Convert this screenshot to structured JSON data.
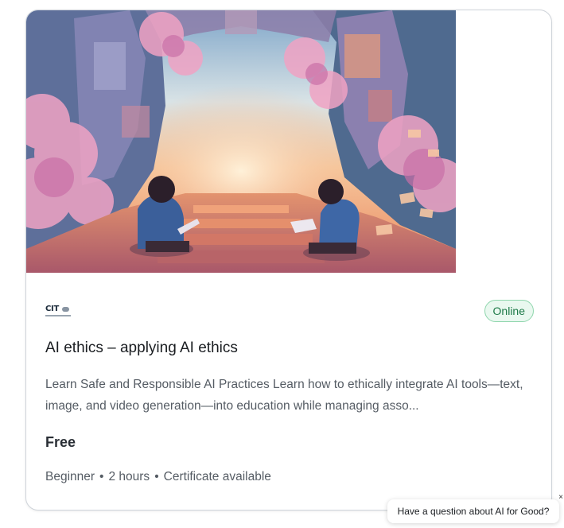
{
  "course": {
    "provider_logo_text": "CIT",
    "delivery_badge": "Online",
    "title": "AI ethics – applying AI ethics",
    "description": "Learn Safe and Responsible AI Practices Learn how to ethically integrate AI tools—text, image, and video generation—into education while managing asso...",
    "price": "Free",
    "meta": {
      "level": "Beginner",
      "duration": "2 hours",
      "certificate": "Certificate available",
      "separator": "•"
    },
    "image_icon": "illustration-two-readers-in-blossoming-ruins"
  },
  "chat_widget": {
    "prompt": "Have a question about AI for Good?",
    "close_symbol": "×"
  },
  "colors": {
    "badge_bg": "#e9f8ef",
    "badge_border": "#8fd6ad",
    "badge_text": "#1d7a48",
    "card_border": "#cfd4da"
  }
}
